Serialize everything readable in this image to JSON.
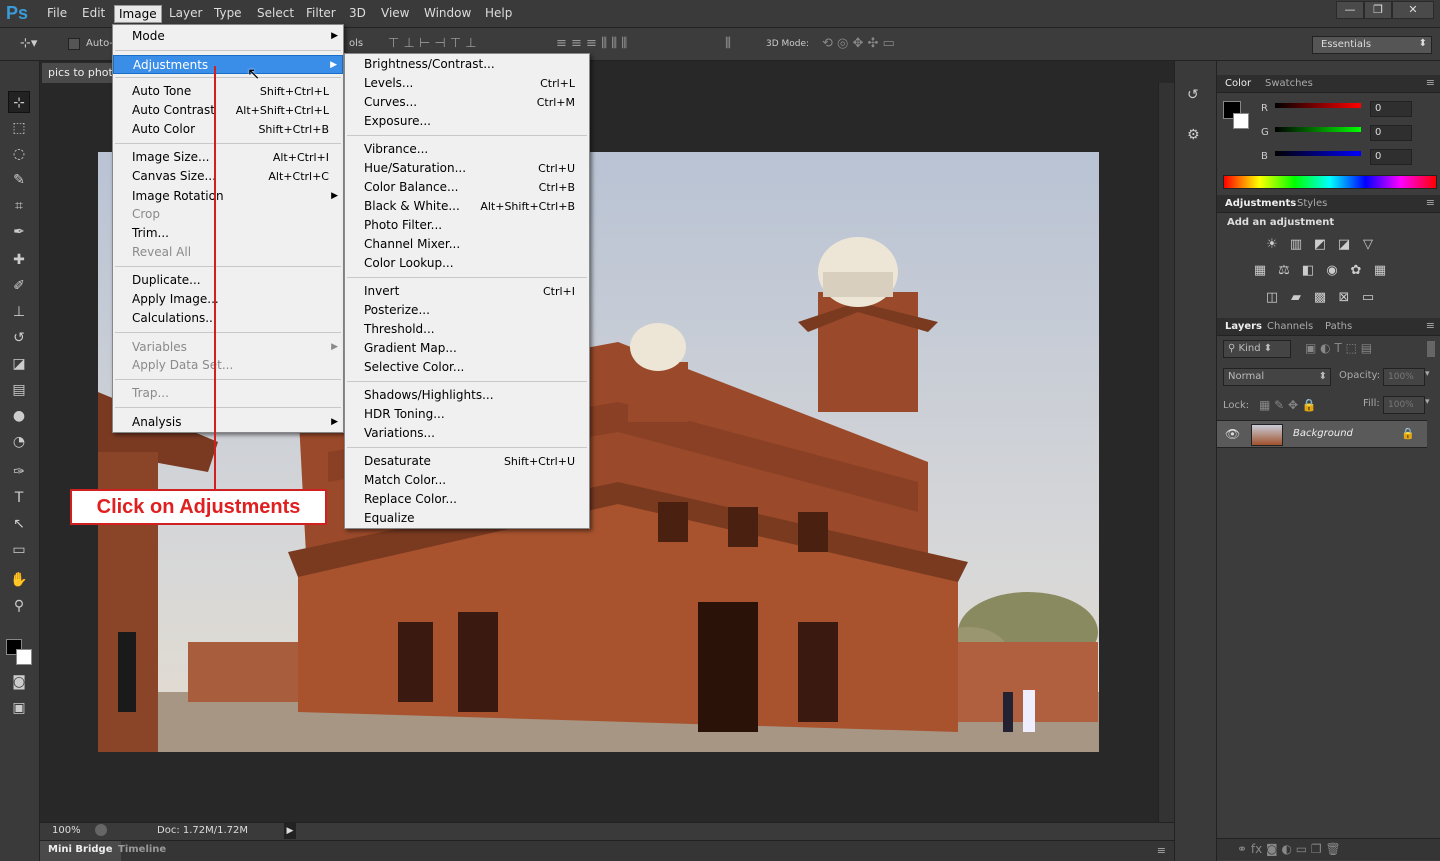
{
  "menubar": {
    "logo": "Ps",
    "items": [
      "File",
      "Edit",
      "Image",
      "Layer",
      "Type",
      "Select",
      "Filter",
      "3D",
      "View",
      "Window",
      "Help"
    ],
    "window_controls": [
      "—",
      "❐",
      "✕"
    ]
  },
  "options_bar": {
    "auto_select_label": "Auto-",
    "cut_text": "ols",
    "mode_3d_label": "3D Mode:",
    "workspace": "Essentials"
  },
  "document": {
    "tab_label": "pics to photo",
    "zoom": "100%",
    "doc_size": "Doc: 1.72M/1.72M"
  },
  "bottom_tabs": [
    "Mini Bridge",
    "Timeline"
  ],
  "image_menu": {
    "items": [
      {
        "label": "Mode",
        "shortcut": "",
        "submenu": true,
        "disabled": false,
        "highlight": false
      },
      {
        "sep": true
      },
      {
        "label": "Adjustments",
        "shortcut": "",
        "submenu": true,
        "disabled": false,
        "highlight": true
      },
      {
        "sep": true
      },
      {
        "label": "Auto Tone",
        "shortcut": "Shift+Ctrl+L",
        "submenu": false,
        "disabled": false,
        "highlight": false
      },
      {
        "label": "Auto Contrast",
        "shortcut": "Alt+Shift+Ctrl+L",
        "submenu": false,
        "disabled": false,
        "highlight": false
      },
      {
        "label": "Auto Color",
        "shortcut": "Shift+Ctrl+B",
        "submenu": false,
        "disabled": false,
        "highlight": false
      },
      {
        "sep": true
      },
      {
        "label": "Image Size...",
        "shortcut": "Alt+Ctrl+I",
        "submenu": false,
        "disabled": false,
        "highlight": false
      },
      {
        "label": "Canvas Size...",
        "shortcut": "Alt+Ctrl+C",
        "submenu": false,
        "disabled": false,
        "highlight": false
      },
      {
        "label": "Image Rotation",
        "shortcut": "",
        "submenu": true,
        "disabled": false,
        "highlight": false
      },
      {
        "label": "Crop",
        "shortcut": "",
        "submenu": false,
        "disabled": true,
        "highlight": false
      },
      {
        "label": "Trim...",
        "shortcut": "",
        "submenu": false,
        "disabled": false,
        "highlight": false
      },
      {
        "label": "Reveal All",
        "shortcut": "",
        "submenu": false,
        "disabled": true,
        "highlight": false
      },
      {
        "sep": true
      },
      {
        "label": "Duplicate...",
        "shortcut": "",
        "submenu": false,
        "disabled": false,
        "highlight": false
      },
      {
        "label": "Apply Image...",
        "shortcut": "",
        "submenu": false,
        "disabled": false,
        "highlight": false
      },
      {
        "label": "Calculations...",
        "shortcut": "",
        "submenu": false,
        "disabled": false,
        "highlight": false
      },
      {
        "sep": true
      },
      {
        "label": "Variables",
        "shortcut": "",
        "submenu": true,
        "disabled": true,
        "highlight": false
      },
      {
        "label": "Apply Data Set...",
        "shortcut": "",
        "submenu": false,
        "disabled": true,
        "highlight": false
      },
      {
        "sep": true
      },
      {
        "label": "Trap...",
        "shortcut": "",
        "submenu": false,
        "disabled": true,
        "highlight": false
      },
      {
        "sep": true
      },
      {
        "label": "Analysis",
        "shortcut": "",
        "submenu": true,
        "disabled": false,
        "highlight": false
      }
    ]
  },
  "adjustments_menu": {
    "items": [
      {
        "label": "Brightness/Contrast...",
        "shortcut": ""
      },
      {
        "label": "Levels...",
        "shortcut": "Ctrl+L"
      },
      {
        "label": "Curves...",
        "shortcut": "Ctrl+M"
      },
      {
        "label": "Exposure...",
        "shortcut": ""
      },
      {
        "sep": true
      },
      {
        "label": "Vibrance...",
        "shortcut": ""
      },
      {
        "label": "Hue/Saturation...",
        "shortcut": "Ctrl+U"
      },
      {
        "label": "Color Balance...",
        "shortcut": "Ctrl+B"
      },
      {
        "label": "Black & White...",
        "shortcut": "Alt+Shift+Ctrl+B"
      },
      {
        "label": "Photo Filter...",
        "shortcut": ""
      },
      {
        "label": "Channel Mixer...",
        "shortcut": ""
      },
      {
        "label": "Color Lookup...",
        "shortcut": ""
      },
      {
        "sep": true
      },
      {
        "label": "Invert",
        "shortcut": "Ctrl+I"
      },
      {
        "label": "Posterize...",
        "shortcut": ""
      },
      {
        "label": "Threshold...",
        "shortcut": ""
      },
      {
        "label": "Gradient Map...",
        "shortcut": ""
      },
      {
        "label": "Selective Color...",
        "shortcut": ""
      },
      {
        "sep": true
      },
      {
        "label": "Shadows/Highlights...",
        "shortcut": ""
      },
      {
        "label": "HDR Toning...",
        "shortcut": ""
      },
      {
        "label": "Variations...",
        "shortcut": ""
      },
      {
        "sep": true
      },
      {
        "label": "Desaturate",
        "shortcut": "Shift+Ctrl+U"
      },
      {
        "label": "Match Color...",
        "shortcut": ""
      },
      {
        "label": "Replace Color...",
        "shortcut": ""
      },
      {
        "label": "Equalize",
        "shortcut": ""
      }
    ]
  },
  "callout": {
    "text": "Click on Adjustments"
  },
  "color_panel": {
    "tabs": [
      "Color",
      "Swatches"
    ],
    "channels": [
      {
        "label": "R",
        "value": "0",
        "color": "#e02020"
      },
      {
        "label": "G",
        "value": "0",
        "color": "#20c020"
      },
      {
        "label": "B",
        "value": "0",
        "color": "#2040e0"
      }
    ]
  },
  "adjustments_panel": {
    "tabs": [
      "Adjustments",
      "Styles"
    ],
    "heading": "Add an adjustment"
  },
  "layers_panel": {
    "tabs": [
      "Layers",
      "Channels",
      "Paths"
    ],
    "filter_kind": "Kind",
    "blend_mode": "Normal",
    "opacity_label": "Opacity:",
    "opacity_value": "100%",
    "lock_label": "Lock:",
    "fill_label": "Fill:",
    "fill_value": "100%",
    "layers": [
      {
        "name": "Background",
        "visible": true,
        "locked": true
      }
    ]
  }
}
